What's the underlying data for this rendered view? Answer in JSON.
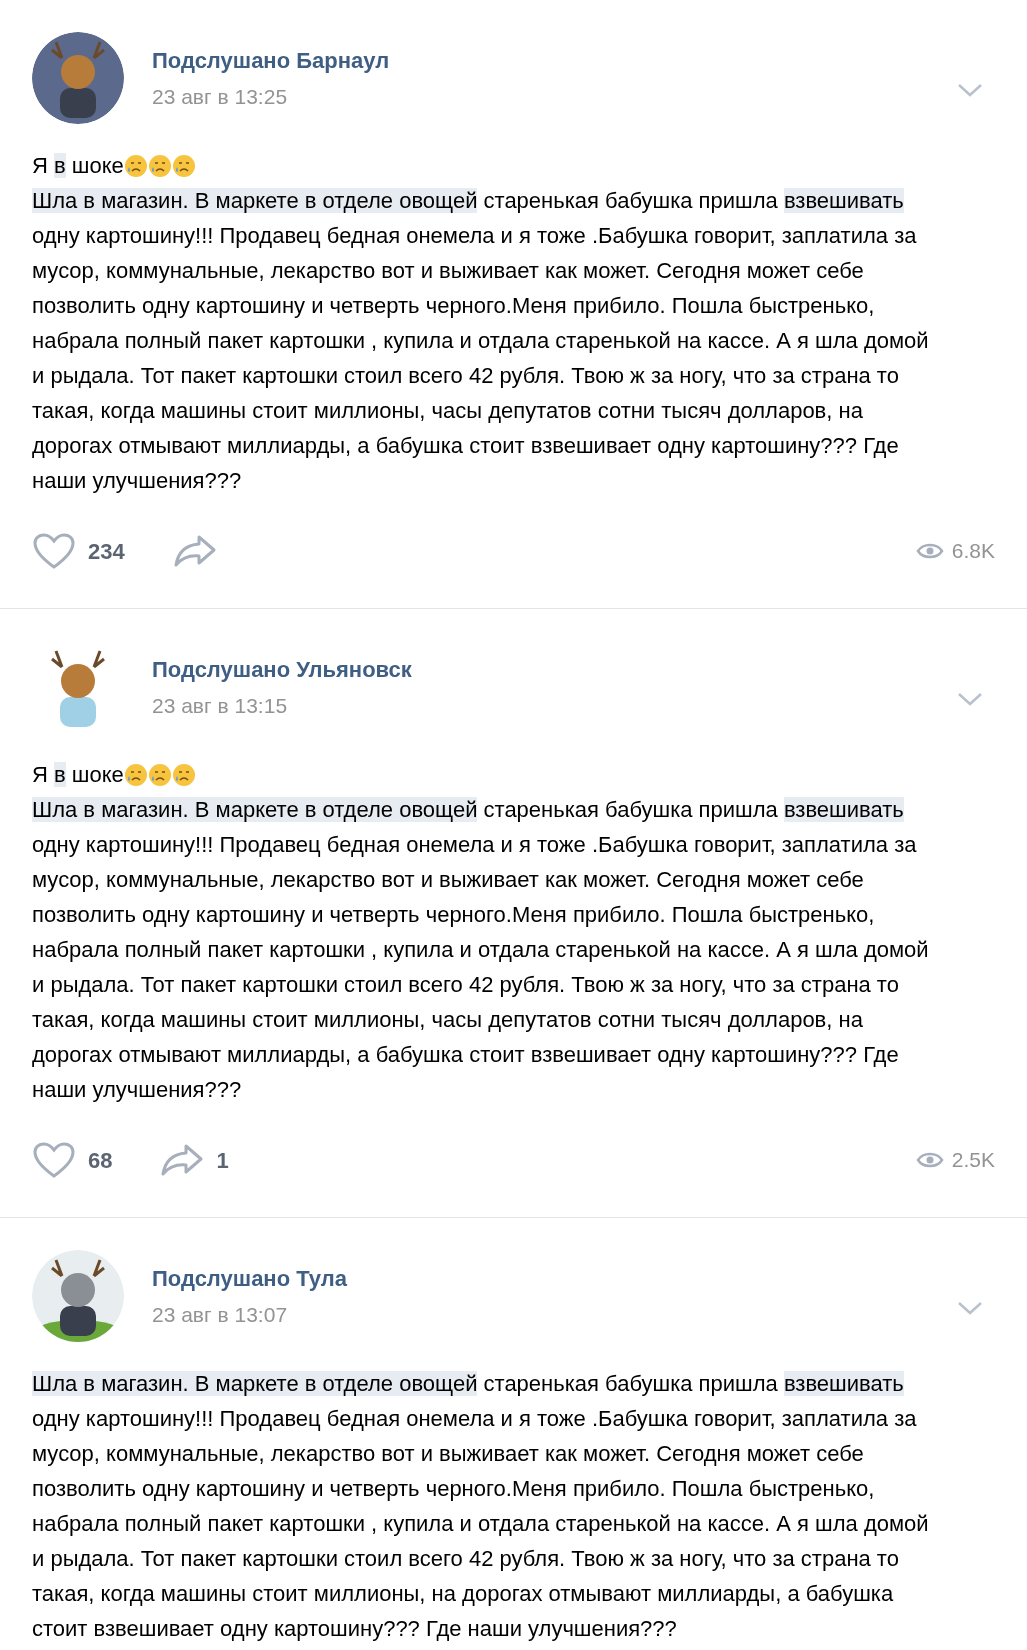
{
  "posts": [
    {
      "author": "Подслушано Барнаул",
      "date": "23 авг в 13:25",
      "avatar": {
        "kind": "picture"
      },
      "headline": [
        {
          "text": "Я "
        },
        {
          "text": "в",
          "highlighted": true
        },
        {
          "text": " шоке"
        }
      ],
      "emojis": [
        {
          "kind": "sad-face"
        },
        {
          "kind": "sad-face"
        },
        {
          "kind": "sad-face"
        }
      ],
      "body": [
        {
          "text": "Шла в магазин. В маркете в отделе овощей",
          "highlighted": true
        },
        {
          "text": " старенькая бабушка пришла "
        },
        {
          "text": "взвешивать",
          "highlighted": true
        },
        {
          "text": " одну картошину!!! Продавец бедная онемела и я тоже .Бабушка говорит, заплатила за мусор, коммунальные, лекарство вот и выживает как может. Сегодня может себе позволить одну картошину и четверть черного.Меня прибило. Пошла быстренько, набрала полный пакет картошки , купила и отдала старенькой на кассе. А я шла домой и рыдала. Тот пакет картошки стоил всего 42 рубля. Твою ж за ногу, что за страна то такая, когда машины стоит миллионы, часы депутатов сотни тысяч долларов, на дорогах отмывают миллиарды, а бабушка стоит взвешивает одну картошину??? Где наши улучшения???"
        }
      ],
      "likes": "234",
      "views": "6.8K"
    },
    {
      "author": "Подслушано Ульяновск",
      "date": "23 авг в 13:15",
      "avatar": {
        "kind": "picture"
      },
      "headline": [
        {
          "text": "Я "
        },
        {
          "text": "в",
          "highlighted": true
        },
        {
          "text": " шоке"
        }
      ],
      "emojis": [
        {
          "kind": "sad-face"
        },
        {
          "kind": "sad-face"
        },
        {
          "kind": "sad-face"
        }
      ],
      "body": [
        {
          "text": "Шла в магазин. В маркете в отделе овощей",
          "highlighted": true
        },
        {
          "text": " старенькая бабушка пришла "
        },
        {
          "text": "взвешивать",
          "highlighted": true
        },
        {
          "text": " одну картошину!!! Продавец бедная онемела и я тоже .Бабушка говорит, заплатила за мусор, коммунальные, лекарство вот и выживает как может. Сегодня может себе позволить одну картошину и четверть черного.Меня прибило. Пошла быстренько, набрала полный пакет картошки , купила и отдала старенькой на кассе. А я шла домой и рыдала. Тот пакет картошки стоил всего 42 рубля. Твою ж за ногу, что за страна то такая, когда машины стоит миллионы, часы депутатов сотни тысяч долларов, на дорогах отмывают миллиарды, а бабушка стоит взвешивает одну картошину??? Где наши улучшения???"
        }
      ],
      "likes": "68",
      "shares": "1",
      "views": "2.5K"
    },
    {
      "author": "Подслушано Тула",
      "date": "23 авг в 13:07",
      "avatar": {
        "kind": "picture"
      },
      "body": [
        {
          "text": "Шла в магазин. В маркете в отделе овощей",
          "highlighted": true
        },
        {
          "text": " старенькая бабушка пришла "
        },
        {
          "text": "взвешивать",
          "highlighted": true
        },
        {
          "text": " одну картошину!!! Продавец бедная онемела и я тоже .Бабушка говорит, заплатила за мусор, коммунальные, лекарство вот и выживает как может. Сегодня может себе позволить одну картошину и четверть черного.Меня прибило. Пошла быстренько, набрала полный пакет картошки , купила и отдала старенькой на кассе. А я шла домой и рыдала. Тот пакет картошки стоил всего 42 рубля. Твою ж за ногу, что за страна то такая, когда машины стоит миллионы, на дорогах отмывают миллиарды, а бабушка стоит взвешивает одну картошину??? Где наши улучшения???"
        }
      ]
    }
  ]
}
